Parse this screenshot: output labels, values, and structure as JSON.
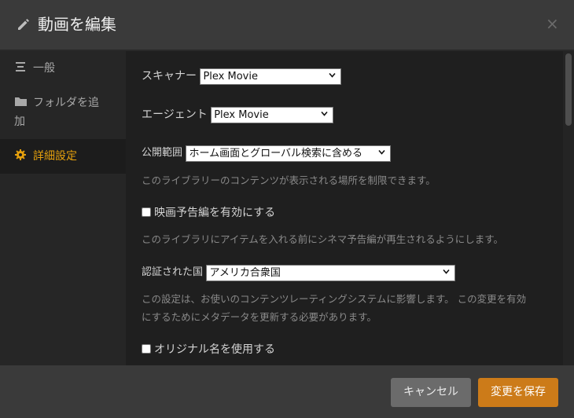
{
  "dialog": {
    "title": "動画を編集",
    "close_glyph": "×",
    "header_icon": "pencil-icon"
  },
  "sidebar": {
    "items": [
      {
        "label": "一般",
        "icon": "list-icon",
        "active": false
      },
      {
        "label": "フォルダを追加",
        "label_line1": "フォルダを追",
        "label_line2": "加",
        "icon": "folder-icon",
        "active": false
      },
      {
        "label": "詳細設定",
        "icon": "gear-icon",
        "active": true
      }
    ]
  },
  "settings": {
    "scanner": {
      "label": "スキャナー",
      "value": "Plex Movie"
    },
    "agent": {
      "label": "エージェント",
      "value": "Plex Movie"
    },
    "visibility": {
      "label": "公開範囲",
      "value": "ホーム画面とグローバル検索に含める",
      "help": "このライブラリーのコンテンツが表示される場所を制限できます。"
    },
    "trailers": {
      "label": "映画予告編を有効にする",
      "checked": false,
      "help": "このライブラリにアイテムを入れる前にシネマ予告編が再生されるようにします。"
    },
    "certification_country": {
      "label": "認証された国",
      "value": "アメリカ合衆国",
      "help_line1": "この設定は、お使いのコンテンツレーティングシステムに影響します。 この変更を有効",
      "help_line2": "にするためにメタデータを更新する必要があります。"
    },
    "original_title": {
      "label": "オリジナル名を使用する",
      "checked": false
    }
  },
  "footer": {
    "cancel_label": "キャンセル",
    "save_label": "変更を保存"
  },
  "colors": {
    "accent": "#e5a00d",
    "save_button": "#cc7b19",
    "cancel_button": "#6b6b6b",
    "header_bg": "#3a3a3a",
    "content_bg": "#1f1f1f"
  }
}
